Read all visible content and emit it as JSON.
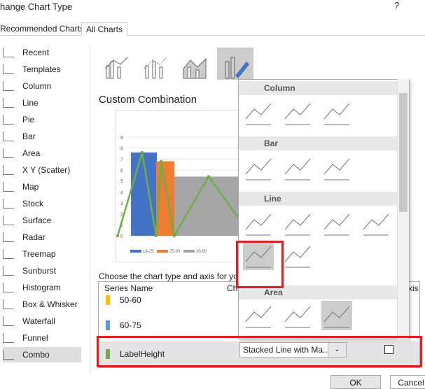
{
  "dialog": {
    "title": "hange Chart Type",
    "help": "?"
  },
  "tabs": [
    {
      "label": "Recommended Charts"
    },
    {
      "label": "All Charts",
      "active": true
    }
  ],
  "sidebar": {
    "items": [
      {
        "label": "Recent"
      },
      {
        "label": "Templates"
      },
      {
        "label": "Column"
      },
      {
        "label": "Line"
      },
      {
        "label": "Pie"
      },
      {
        "label": "Bar"
      },
      {
        "label": "Area"
      },
      {
        "label": "X Y (Scatter)"
      },
      {
        "label": "Map"
      },
      {
        "label": "Stock"
      },
      {
        "label": "Surface"
      },
      {
        "label": "Radar"
      },
      {
        "label": "Treemap"
      },
      {
        "label": "Sunburst"
      },
      {
        "label": "Histogram"
      },
      {
        "label": "Box & Whisker"
      },
      {
        "label": "Waterfall"
      },
      {
        "label": "Funnel"
      },
      {
        "label": "Combo",
        "selected": true
      }
    ]
  },
  "main": {
    "heading": "Custom Combination",
    "choose_label": "Choose the chart type and axis for you",
    "table": {
      "col_series": "Series Name",
      "col_type": "Ch",
      "col_axis": "xis",
      "rows": [
        {
          "name": "50-60",
          "color": "#FFC000"
        },
        {
          "name": "60-75",
          "color": "#5B9BD5"
        },
        {
          "name": "LabelHeight",
          "color": "#70AD47",
          "type": "Stacked Line with Ma...",
          "secondary_axis": false
        }
      ]
    }
  },
  "dropdown": {
    "groups": [
      {
        "label": "Column"
      },
      {
        "label": "Bar"
      },
      {
        "label": "Line"
      },
      {
        "label": "Area"
      }
    ],
    "selected": "Stacked Line with Markers"
  },
  "buttons": {
    "ok": "OK",
    "cancel": "Cancel"
  },
  "chart_data": {
    "type": "bar",
    "ylim": [
      0,
      9
    ],
    "yticks": [
      "0",
      "1",
      "2",
      "3",
      "4",
      "5",
      "6",
      "7",
      "8",
      "9"
    ],
    "series": [
      {
        "name": "18-25",
        "value": 7.6,
        "color": "#4472C4"
      },
      {
        "name": "25-30",
        "value": 6.8,
        "color": "#ED7D31"
      },
      {
        "name": "30-50",
        "value": 5.4,
        "color": "#A5A5A5"
      }
    ],
    "line": {
      "values": [
        0,
        7.6,
        0,
        6.8,
        0,
        5.4
      ],
      "color": "#70AD47"
    }
  }
}
